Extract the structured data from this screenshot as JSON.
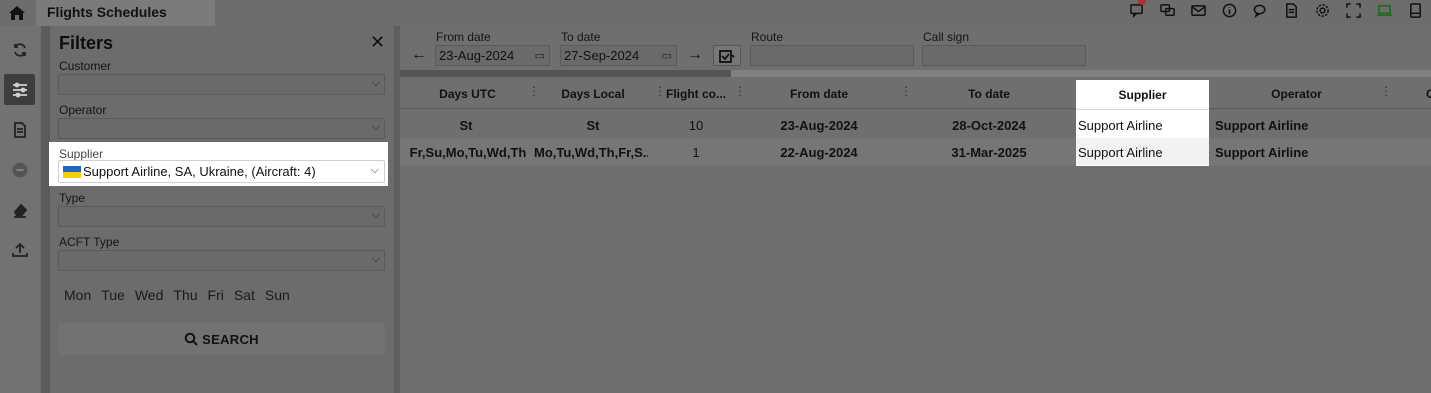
{
  "app": {
    "title": "Flights Schedules"
  },
  "topbar_icons": [
    "chat-notification-icon",
    "conversations-icon",
    "mail-icon",
    "info-icon",
    "comments-icon",
    "report-icon",
    "settings-gear-icon",
    "fullscreen-icon",
    "laptop-icon",
    "tablet-icon"
  ],
  "rail_icons": [
    "refresh-icon",
    "filter-sliders-icon",
    "document-icon",
    "minus-circle-icon",
    "eraser-icon",
    "upload-icon"
  ],
  "filters": {
    "title": "Filters",
    "customer_label": "Customer",
    "operator_label": "Operator",
    "supplier_label": "Supplier",
    "supplier_value": "Support Airline, SA, Ukraine,  (Aircraft: 4)",
    "type_label": "Type",
    "acft_type_label": "ACFT Type",
    "days": [
      "Mon",
      "Tue",
      "Wed",
      "Thu",
      "Fri",
      "Sat",
      "Sun"
    ],
    "search_label": "SEARCH"
  },
  "toolbar": {
    "from_date_label": "From date",
    "from_date_value": "23-Aug-2024",
    "to_date_label": "To date",
    "to_date_value": "27-Sep-2024",
    "route_label": "Route",
    "route_value": "",
    "call_sign_label": "Call sign",
    "call_sign_value": ""
  },
  "grid": {
    "columns": [
      "Days UTC",
      "Days Local",
      "Flight co...",
      "From date",
      "To date",
      "Supplier",
      "Operator",
      "C"
    ],
    "rows": [
      {
        "days_utc": "St",
        "days_local": "St",
        "flight_count": "10",
        "from_date": "23-Aug-2024",
        "to_date": "28-Oct-2024",
        "supplier": "Support Airline",
        "operator": "Support Airline"
      },
      {
        "days_utc": "Fr,Su,Mo,Tu,Wd,Th",
        "days_local": "Mo,Tu,Wd,Th,Fr,S...",
        "flight_count": "1",
        "from_date": "22-Aug-2024",
        "to_date": "31-Mar-2025",
        "supplier": "Support Airline",
        "operator": "Support Airline"
      }
    ]
  },
  "colors": {
    "ukraine_blue": "#2463c6",
    "ukraine_yellow": "#f5d000",
    "notification_badge": "#b03030"
  }
}
